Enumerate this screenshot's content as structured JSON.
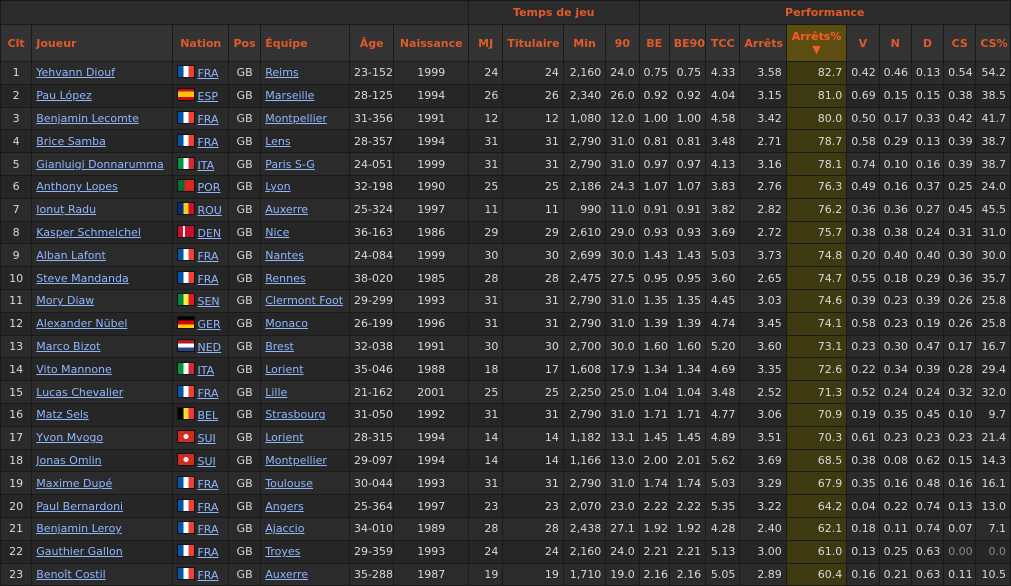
{
  "groups": {
    "playing_time": "Temps de jeu",
    "performance": "Performance"
  },
  "columns": {
    "rk": "Clt",
    "player": "Joueur",
    "nation": "Nation",
    "pos": "Pos",
    "squad": "Équipe",
    "age": "Âge",
    "born": "Naissance",
    "mp": "MJ",
    "starts": "Titulaire",
    "min": "Min",
    "n90": "90",
    "ga": "BE",
    "ga90": "BE90",
    "sota": "TCC",
    "saves": "Arrêts",
    "savepct": "Arrêts%",
    "sort_arrow": "▼",
    "w": "V",
    "d": "N",
    "l": "D",
    "cs": "CS",
    "cspct": "CS%"
  },
  "flags": {
    "FRA": [
      "#0055a4",
      "#ffffff",
      "#ef4135"
    ],
    "ESP": [
      "#c60b1e",
      "#ffc400",
      "#c60b1e"
    ],
    "ITA": [
      "#009246",
      "#ffffff",
      "#ce2b37"
    ],
    "POR": [
      "#046a38",
      "#da291c",
      "#da291c"
    ],
    "ROU": [
      "#002b7f",
      "#fcd116",
      "#ce1126"
    ],
    "DEN": [
      "#c8102e",
      "#ffffff",
      "#c8102e"
    ],
    "SEN": [
      "#00853f",
      "#fdef42",
      "#e31b23"
    ],
    "GER": [
      "#000000",
      "#dd0000",
      "#ffce00"
    ],
    "NED": [
      "#ae1c28",
      "#ffffff",
      "#21468b"
    ],
    "BEL": [
      "#000000",
      "#fdda24",
      "#ef3340"
    ],
    "SUI": [
      "#d52b1e",
      "#d52b1e",
      "#d52b1e"
    ]
  },
  "rows": [
    {
      "rk": "1",
      "player": "Yehvann Diouf",
      "nation": "FRA",
      "pos": "GB",
      "squad": "Reims",
      "age": "23-152",
      "born": "1999",
      "mp": "24",
      "starts": "24",
      "min": "2,160",
      "n90": "24.0",
      "ga": "0.75",
      "ga90": "0.75",
      "sota": "4.33",
      "saves": "3.58",
      "savepct": "82.7",
      "w": "0.42",
      "d": "0.46",
      "l": "0.13",
      "cs": "0.54",
      "cspct": "54.2"
    },
    {
      "rk": "2",
      "player": "Pau López",
      "nation": "ESP",
      "pos": "GB",
      "squad": "Marseille",
      "age": "28-125",
      "born": "1994",
      "mp": "26",
      "starts": "26",
      "min": "2,340",
      "n90": "26.0",
      "ga": "0.92",
      "ga90": "0.92",
      "sota": "4.04",
      "saves": "3.15",
      "savepct": "81.0",
      "w": "0.69",
      "d": "0.15",
      "l": "0.15",
      "cs": "0.38",
      "cspct": "38.5"
    },
    {
      "rk": "3",
      "player": "Benjamin Lecomte",
      "nation": "FRA",
      "pos": "GB",
      "squad": "Montpellier",
      "age": "31-356",
      "born": "1991",
      "mp": "12",
      "starts": "12",
      "min": "1,080",
      "n90": "12.0",
      "ga": "1.00",
      "ga90": "1.00",
      "sota": "4.58",
      "saves": "3.42",
      "savepct": "80.0",
      "w": "0.50",
      "d": "0.17",
      "l": "0.33",
      "cs": "0.42",
      "cspct": "41.7"
    },
    {
      "rk": "4",
      "player": "Brice Samba",
      "nation": "FRA",
      "pos": "GB",
      "squad": "Lens",
      "age": "28-357",
      "born": "1994",
      "mp": "31",
      "starts": "31",
      "min": "2,790",
      "n90": "31.0",
      "ga": "0.81",
      "ga90": "0.81",
      "sota": "3.48",
      "saves": "2.71",
      "savepct": "78.7",
      "w": "0.58",
      "d": "0.29",
      "l": "0.13",
      "cs": "0.39",
      "cspct": "38.7"
    },
    {
      "rk": "5",
      "player": "Gianluigi Donnarumma",
      "nation": "ITA",
      "pos": "GB",
      "squad": "Paris S-G",
      "age": "24-051",
      "born": "1999",
      "mp": "31",
      "starts": "31",
      "min": "2,790",
      "n90": "31.0",
      "ga": "0.97",
      "ga90": "0.97",
      "sota": "4.13",
      "saves": "3.16",
      "savepct": "78.1",
      "w": "0.74",
      "d": "0.10",
      "l": "0.16",
      "cs": "0.39",
      "cspct": "38.7"
    },
    {
      "rk": "6",
      "player": "Anthony Lopes",
      "nation": "POR",
      "pos": "GB",
      "squad": "Lyon",
      "age": "32-198",
      "born": "1990",
      "mp": "25",
      "starts": "25",
      "min": "2,186",
      "n90": "24.3",
      "ga": "1.07",
      "ga90": "1.07",
      "sota": "3.83",
      "saves": "2.76",
      "savepct": "76.3",
      "w": "0.49",
      "d": "0.16",
      "l": "0.37",
      "cs": "0.25",
      "cspct": "24.0"
    },
    {
      "rk": "7",
      "player": "Ionuț Radu",
      "nation": "ROU",
      "pos": "GB",
      "squad": "Auxerre",
      "age": "25-324",
      "born": "1997",
      "mp": "11",
      "starts": "11",
      "min": "990",
      "n90": "11.0",
      "ga": "0.91",
      "ga90": "0.91",
      "sota": "3.82",
      "saves": "2.82",
      "savepct": "76.2",
      "w": "0.36",
      "d": "0.36",
      "l": "0.27",
      "cs": "0.45",
      "cspct": "45.5"
    },
    {
      "rk": "8",
      "player": "Kasper Schmeichel",
      "nation": "DEN",
      "pos": "GB",
      "squad": "Nice",
      "age": "36-163",
      "born": "1986",
      "mp": "29",
      "starts": "29",
      "min": "2,610",
      "n90": "29.0",
      "ga": "0.93",
      "ga90": "0.93",
      "sota": "3.69",
      "saves": "2.72",
      "savepct": "75.7",
      "w": "0.38",
      "d": "0.38",
      "l": "0.24",
      "cs": "0.31",
      "cspct": "31.0"
    },
    {
      "rk": "9",
      "player": "Alban Lafont",
      "nation": "FRA",
      "pos": "GB",
      "squad": "Nantes",
      "age": "24-084",
      "born": "1999",
      "mp": "30",
      "starts": "30",
      "min": "2,699",
      "n90": "30.0",
      "ga": "1.43",
      "ga90": "1.43",
      "sota": "5.03",
      "saves": "3.73",
      "savepct": "74.8",
      "w": "0.20",
      "d": "0.40",
      "l": "0.40",
      "cs": "0.30",
      "cspct": "30.0"
    },
    {
      "rk": "10",
      "player": "Steve Mandanda",
      "nation": "FRA",
      "pos": "GB",
      "squad": "Rennes",
      "age": "38-020",
      "born": "1985",
      "mp": "28",
      "starts": "28",
      "min": "2,475",
      "n90": "27.5",
      "ga": "0.95",
      "ga90": "0.95",
      "sota": "3.60",
      "saves": "2.65",
      "savepct": "74.7",
      "w": "0.55",
      "d": "0.18",
      "l": "0.29",
      "cs": "0.36",
      "cspct": "35.7"
    },
    {
      "rk": "11",
      "player": "Mory Diaw",
      "nation": "SEN",
      "pos": "GB",
      "squad": "Clermont Foot",
      "age": "29-299",
      "born": "1993",
      "mp": "31",
      "starts": "31",
      "min": "2,790",
      "n90": "31.0",
      "ga": "1.35",
      "ga90": "1.35",
      "sota": "4.45",
      "saves": "3.03",
      "savepct": "74.6",
      "w": "0.39",
      "d": "0.23",
      "l": "0.39",
      "cs": "0.26",
      "cspct": "25.8"
    },
    {
      "rk": "12",
      "player": "Alexander Nübel",
      "nation": "GER",
      "pos": "GB",
      "squad": "Monaco",
      "age": "26-199",
      "born": "1996",
      "mp": "31",
      "starts": "31",
      "min": "2,790",
      "n90": "31.0",
      "ga": "1.39",
      "ga90": "1.39",
      "sota": "4.74",
      "saves": "3.45",
      "savepct": "74.1",
      "w": "0.58",
      "d": "0.23",
      "l": "0.19",
      "cs": "0.26",
      "cspct": "25.8"
    },
    {
      "rk": "13",
      "player": "Marco Bizot",
      "nation": "NED",
      "pos": "GB",
      "squad": "Brest",
      "age": "32-038",
      "born": "1991",
      "mp": "30",
      "starts": "30",
      "min": "2,700",
      "n90": "30.0",
      "ga": "1.60",
      "ga90": "1.60",
      "sota": "5.20",
      "saves": "3.60",
      "savepct": "73.1",
      "w": "0.23",
      "d": "0.30",
      "l": "0.47",
      "cs": "0.17",
      "cspct": "16.7"
    },
    {
      "rk": "14",
      "player": "Vito Mannone",
      "nation": "ITA",
      "pos": "GB",
      "squad": "Lorient",
      "age": "35-046",
      "born": "1988",
      "mp": "18",
      "starts": "17",
      "min": "1,608",
      "n90": "17.9",
      "ga": "1.34",
      "ga90": "1.34",
      "sota": "4.69",
      "saves": "3.35",
      "savepct": "72.6",
      "w": "0.22",
      "d": "0.34",
      "l": "0.39",
      "cs": "0.28",
      "cspct": "29.4"
    },
    {
      "rk": "15",
      "player": "Lucas Chevalier",
      "nation": "FRA",
      "pos": "GB",
      "squad": "Lille",
      "age": "21-162",
      "born": "2001",
      "mp": "25",
      "starts": "25",
      "min": "2,250",
      "n90": "25.0",
      "ga": "1.04",
      "ga90": "1.04",
      "sota": "3.48",
      "saves": "2.52",
      "savepct": "71.3",
      "w": "0.52",
      "d": "0.24",
      "l": "0.24",
      "cs": "0.32",
      "cspct": "32.0"
    },
    {
      "rk": "16",
      "player": "Matz Sels",
      "nation": "BEL",
      "pos": "GB",
      "squad": "Strasbourg",
      "age": "31-050",
      "born": "1992",
      "mp": "31",
      "starts": "31",
      "min": "2,790",
      "n90": "31.0",
      "ga": "1.71",
      "ga90": "1.71",
      "sota": "4.77",
      "saves": "3.06",
      "savepct": "70.9",
      "w": "0.19",
      "d": "0.35",
      "l": "0.45",
      "cs": "0.10",
      "cspct": "9.7"
    },
    {
      "rk": "17",
      "player": "Yvon Mvogo",
      "nation": "SUI",
      "pos": "GB",
      "squad": "Lorient",
      "age": "28-315",
      "born": "1994",
      "mp": "14",
      "starts": "14",
      "min": "1,182",
      "n90": "13.1",
      "ga": "1.45",
      "ga90": "1.45",
      "sota": "4.89",
      "saves": "3.51",
      "savepct": "70.3",
      "w": "0.61",
      "d": "0.23",
      "l": "0.23",
      "cs": "0.23",
      "cspct": "21.4"
    },
    {
      "rk": "18",
      "player": "Jonas Omlin",
      "nation": "SUI",
      "pos": "GB",
      "squad": "Montpellier",
      "age": "29-097",
      "born": "1994",
      "mp": "14",
      "starts": "14",
      "min": "1,166",
      "n90": "13.0",
      "ga": "2.00",
      "ga90": "2.01",
      "sota": "5.62",
      "saves": "3.69",
      "savepct": "68.5",
      "w": "0.38",
      "d": "0.08",
      "l": "0.62",
      "cs": "0.15",
      "cspct": "14.3"
    },
    {
      "rk": "19",
      "player": "Maxime Dupé",
      "nation": "FRA",
      "pos": "GB",
      "squad": "Toulouse",
      "age": "30-044",
      "born": "1993",
      "mp": "31",
      "starts": "31",
      "min": "2,790",
      "n90": "31.0",
      "ga": "1.74",
      "ga90": "1.74",
      "sota": "5.03",
      "saves": "3.29",
      "savepct": "67.9",
      "w": "0.35",
      "d": "0.16",
      "l": "0.48",
      "cs": "0.16",
      "cspct": "16.1"
    },
    {
      "rk": "20",
      "player": "Paul Bernardoni",
      "nation": "FRA",
      "pos": "GB",
      "squad": "Angers",
      "age": "25-364",
      "born": "1997",
      "mp": "23",
      "starts": "23",
      "min": "2,070",
      "n90": "23.0",
      "ga": "2.22",
      "ga90": "2.22",
      "sota": "5.35",
      "saves": "3.22",
      "savepct": "64.2",
      "w": "0.04",
      "d": "0.22",
      "l": "0.74",
      "cs": "0.13",
      "cspct": "13.0"
    },
    {
      "rk": "21",
      "player": "Benjamin Leroy",
      "nation": "FRA",
      "pos": "GB",
      "squad": "Ajaccio",
      "age": "34-010",
      "born": "1989",
      "mp": "28",
      "starts": "28",
      "min": "2,438",
      "n90": "27.1",
      "ga": "1.92",
      "ga90": "1.92",
      "sota": "4.28",
      "saves": "2.40",
      "savepct": "62.1",
      "w": "0.18",
      "d": "0.11",
      "l": "0.74",
      "cs": "0.07",
      "cspct": "7.1"
    },
    {
      "rk": "22",
      "player": "Gauthier Gallon",
      "nation": "FRA",
      "pos": "GB",
      "squad": "Troyes",
      "age": "29-359",
      "born": "1993",
      "mp": "24",
      "starts": "24",
      "min": "2,160",
      "n90": "24.0",
      "ga": "2.21",
      "ga90": "2.21",
      "sota": "5.13",
      "saves": "3.00",
      "savepct": "61.0",
      "w": "0.13",
      "d": "0.25",
      "l": "0.63",
      "cs": "0.00",
      "cspct": "0.0"
    },
    {
      "rk": "23",
      "player": "Benoît Costil",
      "nation": "FRA",
      "pos": "GB",
      "squad": "Auxerre",
      "age": "35-288",
      "born": "1987",
      "mp": "19",
      "starts": "19",
      "min": "1,710",
      "n90": "19.0",
      "ga": "2.16",
      "ga90": "2.16",
      "sota": "5.05",
      "saves": "2.89",
      "savepct": "60.4",
      "w": "0.16",
      "d": "0.21",
      "l": "0.63",
      "cs": "0.11",
      "cspct": "10.5"
    }
  ]
}
